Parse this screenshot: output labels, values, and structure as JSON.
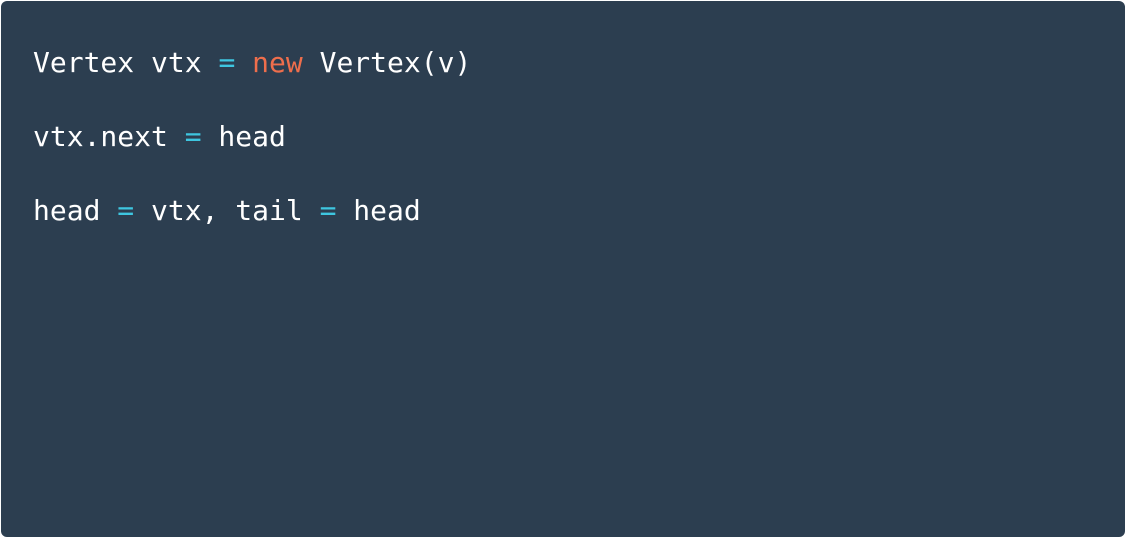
{
  "code": {
    "line1": {
      "t1": "Vertex vtx ",
      "op1": "=",
      "t2": " ",
      "kw1": "new",
      "t3": " Vertex(v)"
    },
    "line2": {
      "t1": "vtx.next ",
      "op1": "=",
      "t2": " head"
    },
    "line3": {
      "t1": "head ",
      "op1": "=",
      "t2": " vtx, tail ",
      "op2": "=",
      "t3": " head"
    }
  },
  "colors": {
    "background": "#2c3e50",
    "text": "#ffffff",
    "operator": "#3ec6e0",
    "keyword": "#ee6e4c"
  }
}
